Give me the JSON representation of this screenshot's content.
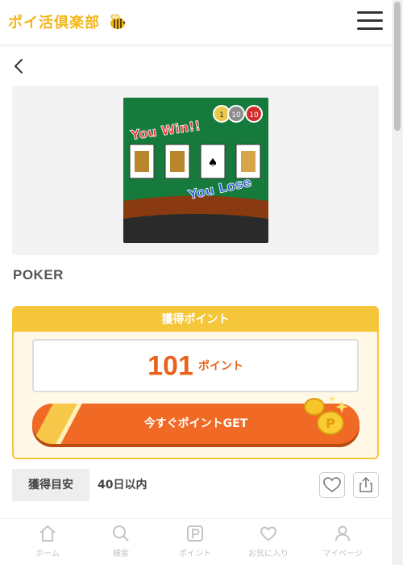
{
  "header": {
    "logo_text": "ポイ活倶楽部",
    "menu_icon": "hamburger-menu-icon"
  },
  "game": {
    "image_text_win": "You Win!!",
    "image_text_lose": "You Lose",
    "image_chips": [
      "1",
      "10",
      "10"
    ],
    "title": "POKER"
  },
  "points": {
    "heading": "獲得ポイント",
    "value": "101",
    "unit": "ポイント",
    "button_label": "今すぐポイントGET"
  },
  "estimate": {
    "label": "獲得目安",
    "value": "40日以内"
  },
  "bottom_nav": {
    "items": [
      {
        "label": "ホーム",
        "icon": "home-icon"
      },
      {
        "label": "検索",
        "icon": "search-icon"
      },
      {
        "label": "ポイント",
        "icon": "point-p-icon"
      },
      {
        "label": "お気に入り",
        "icon": "heart-icon"
      },
      {
        "label": "マイページ",
        "icon": "user-icon"
      }
    ]
  },
  "colors": {
    "brand_yellow": "#f6c63a",
    "accent_orange": "#f06a26",
    "points_text": "#e8641d",
    "nav_gray": "#c4c4c4"
  }
}
